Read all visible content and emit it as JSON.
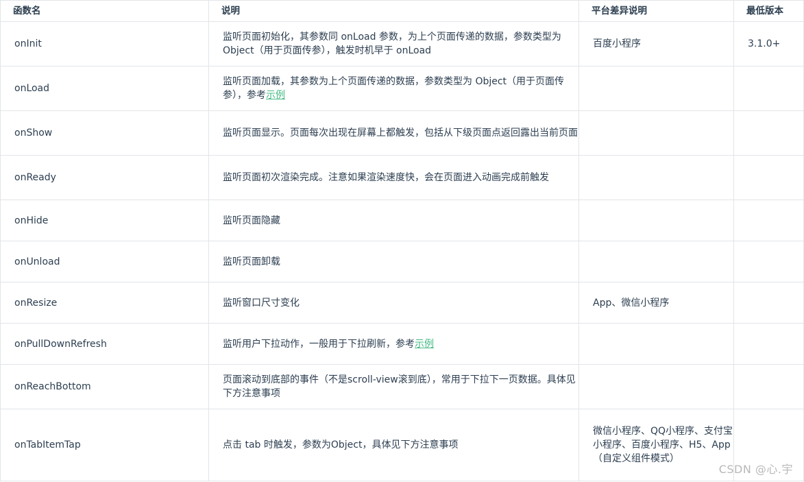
{
  "headers": {
    "name": "函数名",
    "desc": "说明",
    "platform": "平台差异说明",
    "version": "最低版本"
  },
  "rows": [
    {
      "name": "onInit",
      "desc": "监听页面初始化，其参数同 onLoad 参数，为上个页面传递的数据，参数类型为 Object（用于页面传参），触发时机早于 onLoad",
      "link": "",
      "platform": "百度小程序",
      "version": "3.1.0+"
    },
    {
      "name": "onLoad",
      "desc": "监听页面加载，其参数为上个页面传递的数据，参数类型为 Object（用于页面传参），参考",
      "link": "示例",
      "platform": "",
      "version": ""
    },
    {
      "name": "onShow",
      "desc": "监听页面显示。页面每次出现在屏幕上都触发，包括从下级页面点返回露出当前页面",
      "link": "",
      "platform": "",
      "version": ""
    },
    {
      "name": "onReady",
      "desc": "监听页面初次渲染完成。注意如果渲染速度快，会在页面进入动画完成前触发",
      "link": "",
      "platform": "",
      "version": ""
    },
    {
      "name": "onHide",
      "desc": "监听页面隐藏",
      "link": "",
      "platform": "",
      "version": ""
    },
    {
      "name": "onUnload",
      "desc": "监听页面卸载",
      "link": "",
      "platform": "",
      "version": ""
    },
    {
      "name": "onResize",
      "desc": "监听窗口尺寸变化",
      "link": "",
      "platform": "App、微信小程序",
      "version": ""
    },
    {
      "name": "onPullDownRefresh",
      "desc": "监听用户下拉动作，一般用于下拉刷新，参考",
      "link": "示例",
      "platform": "",
      "version": ""
    },
    {
      "name": "onReachBottom",
      "desc": "页面滚动到底部的事件（不是scroll-view滚到底），常用于下拉下一页数据。具体见下方注意事项",
      "link": "",
      "platform": "",
      "version": ""
    },
    {
      "name": "onTabItemTap",
      "desc": "点击 tab 时触发，参数为Object，具体见下方注意事项",
      "link": "",
      "platform": "微信小程序、QQ小程序、支付宝小程序、百度小程序、H5、App（自定义组件模式）",
      "version": ""
    }
  ],
  "watermark": "CSDN @心.宇"
}
